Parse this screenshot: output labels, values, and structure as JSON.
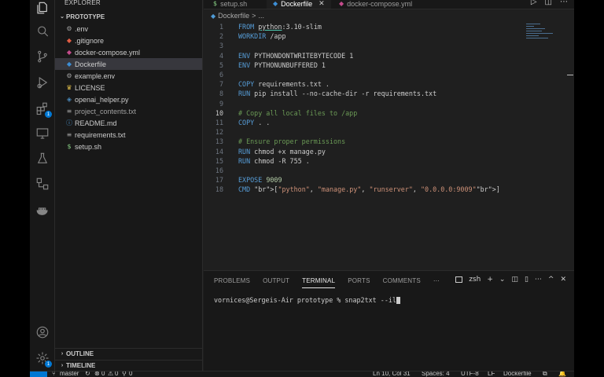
{
  "sidebar": {
    "title": "EXPLORER",
    "project": "PROTOTYPE",
    "files": [
      {
        "name": ".env",
        "icon": "⚙",
        "color": "#a0a0a0"
      },
      {
        "name": ".gitignore",
        "icon": "◆",
        "color": "#e15d44"
      },
      {
        "name": "docker-compose.yml",
        "icon": "🐳",
        "color": "#c54b8c"
      },
      {
        "name": "Dockerfile",
        "icon": "🐳",
        "color": "#3d8fd6",
        "selected": true
      },
      {
        "name": "example.env",
        "icon": "⚙",
        "color": "#a0a0a0"
      },
      {
        "name": "LICENSE",
        "icon": "♛",
        "color": "#e3c14b"
      },
      {
        "name": "openai_helper.py",
        "icon": "◈",
        "color": "#4b8bbe"
      },
      {
        "name": "project_contents.txt",
        "icon": "≡",
        "color": "#a0a0a0",
        "dim": true
      },
      {
        "name": "README.md",
        "icon": "ⓘ",
        "color": "#4f9bd6"
      },
      {
        "name": "requirements.txt",
        "icon": "≡",
        "color": "#a0a0a0"
      },
      {
        "name": "setup.sh",
        "icon": "$",
        "color": "#89d185"
      }
    ],
    "outline": "OUTLINE",
    "timeline": "TIMELINE"
  },
  "tabs": [
    {
      "label": "setup.sh",
      "icon": "$",
      "color": "#89d185"
    },
    {
      "label": "Dockerfile",
      "icon": "🐳",
      "color": "#3d8fd6",
      "active": true,
      "close": "✕"
    },
    {
      "label": "docker-compose.yml",
      "icon": "🐳",
      "color": "#c54b8c"
    }
  ],
  "tab_actions": [
    "▷",
    "◫",
    "⋯"
  ],
  "breadcrumb": {
    "file": "Dockerfile",
    "sep": ">",
    "rest": "..."
  },
  "editor": {
    "current_line": 10,
    "lines": [
      {
        "n": "1",
        "parts": [
          [
            "kw",
            "FROM "
          ],
          [
            "ul",
            "python"
          ],
          [
            "",
            "3.10-slim"
          ]
        ],
        "raw": "FROM python:3.10-slim"
      },
      {
        "n": "2",
        "raw": "WORKDIR /app"
      },
      {
        "n": "3",
        "raw": ""
      },
      {
        "n": "4",
        "raw": "ENV PYTHONDONTWRITEBYTECODE 1"
      },
      {
        "n": "5",
        "raw": "ENV PYTHONUNBUFFERED 1"
      },
      {
        "n": "6",
        "raw": ""
      },
      {
        "n": "7",
        "raw": "COPY requirements.txt ."
      },
      {
        "n": "8",
        "raw": "RUN pip install --no-cache-dir -r requirements.txt"
      },
      {
        "n": "9",
        "raw": ""
      },
      {
        "n": "10",
        "raw": "# Copy all local files to /app"
      },
      {
        "n": "11",
        "raw": "COPY . ."
      },
      {
        "n": "12",
        "raw": ""
      },
      {
        "n": "13",
        "raw": "# Ensure proper permissions"
      },
      {
        "n": "14",
        "raw": "RUN chmod +x manage.py"
      },
      {
        "n": "15",
        "raw": "RUN chmod -R 755 ."
      },
      {
        "n": "16",
        "raw": ""
      },
      {
        "n": "17",
        "raw": "EXPOSE 9009"
      },
      {
        "n": "18",
        "raw": "CMD [\"python\", \"manage.py\", \"runserver\", \"0.0.0.0:9009\"]"
      }
    ]
  },
  "panel": {
    "tabs": [
      "PROBLEMS",
      "OUTPUT",
      "TERMINAL",
      "PORTS",
      "COMMENTS",
      "⋯"
    ],
    "active_tab": "TERMINAL",
    "shell": "zsh",
    "actions": [
      "+",
      "⌄",
      "◫",
      "🗑",
      "⋯",
      "^",
      "✕"
    ],
    "prompt": "vornices@Sergeis-Air prototype % snap2txt --il"
  },
  "statusbar": {
    "branch": "master",
    "sync": "↻",
    "errors": "0",
    "warnings": "0",
    "ports": "0",
    "position": "Ln 10, Col 31",
    "spaces": "Spaces: 4",
    "encoding": "UTF-8",
    "eol": "LF",
    "language": "Dockerfile"
  }
}
